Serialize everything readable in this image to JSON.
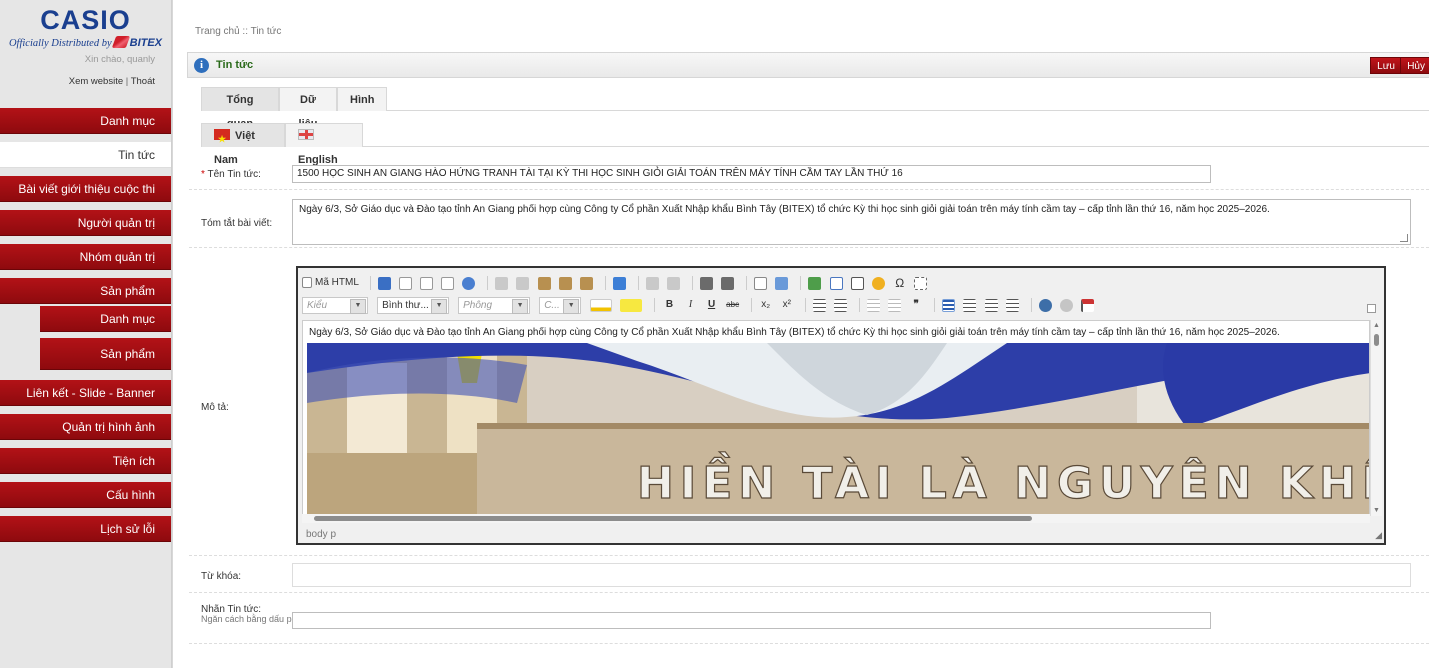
{
  "sidebar": {
    "brand": "CASIO",
    "distributed_by": "Officially Distributed by",
    "distributor": "BITEX",
    "greeting": "Xin chào, quanly",
    "view_site": "Xem website",
    "separator": "|",
    "logout": "Thoát",
    "items": [
      {
        "label": "Danh mục"
      },
      {
        "label": "Tin tức"
      },
      {
        "label": "Bài viết giới thiệu cuộc thi"
      },
      {
        "label": "Người quản trị"
      },
      {
        "label": "Nhóm quản trị"
      },
      {
        "label": "Sản phẩm"
      },
      {
        "label": "Danh mục"
      },
      {
        "label": "Sản phẩm"
      },
      {
        "label": "Liên kết - Slide - Banner"
      },
      {
        "label": "Quản trị hình ảnh"
      },
      {
        "label": "Tiện ích"
      },
      {
        "label": "Cấu hình"
      },
      {
        "label": "Lịch sử lỗi"
      }
    ]
  },
  "breadcrumb": "Trang chủ :: Tin tức",
  "header": {
    "title": "Tin tức",
    "save_label": "Lưu",
    "cancel_label": "Hủy"
  },
  "tabs": [
    {
      "label": "Tổng quan"
    },
    {
      "label": "Dữ liệu"
    },
    {
      "label": "Hình"
    }
  ],
  "lang_tabs": [
    {
      "label": "Việt Nam"
    },
    {
      "label": "English"
    }
  ],
  "form": {
    "title_required_mark": "*",
    "title_label": "Tên Tin tức:",
    "title_value": "1500 HỌC SINH AN GIANG HÀO HỨNG TRANH TÀI TẠI KỲ THI HỌC SINH GIỎI GIẢI TOÁN TRÊN MÁY TÍNH CẦM TAY LẦN THỨ 16",
    "summary_label": "Tóm tắt bài viết:",
    "summary_value": "Ngày 6/3, Sở Giáo dục và Đào tạo tỉnh An Giang phối hợp cùng Công ty Cổ phần Xuất Nhập khẩu Bình Tây (BITEX) tổ chức Kỳ thi học sinh giỏi giải toán trên máy tính cầm tay – cấp tỉnh lần thứ 16, năm học 2025–2026.",
    "description_label": "Mô tả:",
    "keywords_label": "Từ khóa:",
    "keywords_value": "",
    "tags_label": "Nhãn Tin tức:",
    "tags_hint": "Ngăn cách bằng dấu phẩy",
    "tags_value": ""
  },
  "editor": {
    "source_label": "Mã HTML",
    "style_placeholder": "Kiểu",
    "format_value": "Bình thư...",
    "font_placeholder": "Phông",
    "size_placeholder": "C...",
    "body_text": "Ngày 6/3, Sở Giáo dục và Đào tạo tỉnh An Giang phối hợp cùng Công ty Cổ phần Xuất Nhập khẩu Bình Tây (BITEX) tổ chức Kỳ thi học sinh giỏi giải toán trên máy tính cầm tay – cấp tỉnh lần thứ 16, năm học 2025–2026.",
    "photo_text": "HIỀN TÀI LÀ NGUYÊN KHÍ",
    "path": "body  p",
    "bold": "B",
    "italic": "I",
    "underline": "U",
    "strike": "abc",
    "subscript": "x₂",
    "superscript": "x²",
    "quote": "❞"
  },
  "colors": {
    "nav_red": "#a80f14",
    "title_green": "#2a6a1a",
    "brand_blue": "#1a3f8f"
  }
}
